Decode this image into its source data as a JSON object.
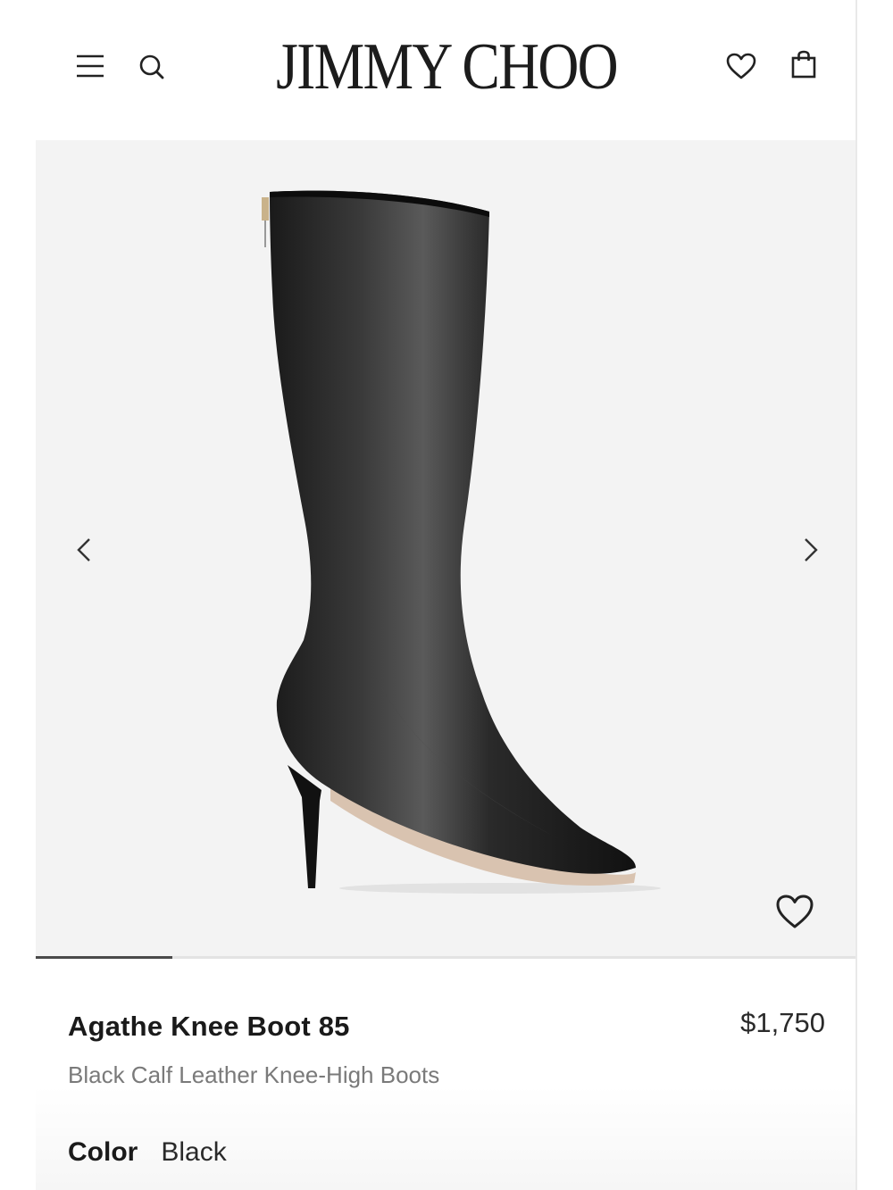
{
  "header": {
    "brand": "JIMMY CHOO",
    "menu_icon": "menu-icon",
    "search_icon": "search-icon",
    "wishlist_icon": "heart-icon",
    "bag_icon": "shopping-bag-icon"
  },
  "gallery": {
    "image_alt_icon": "boot-product-image",
    "prev_icon": "chevron-left-icon",
    "next_icon": "chevron-right-icon",
    "favorite_icon": "heart-icon",
    "progress_fraction": 0.167
  },
  "product": {
    "name": "Agathe Knee Boot 85",
    "price": "$1,750",
    "description": "Black Calf Leather Knee-High Boots",
    "color_label": "Color",
    "color_value": "Black"
  },
  "colors": {
    "background": "#ffffff",
    "gallery_bg": "#f3f3f3",
    "text": "#1a1a1a",
    "muted_text": "#7a7a7a"
  }
}
